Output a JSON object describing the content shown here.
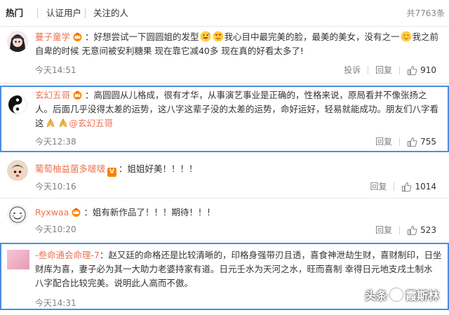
{
  "tabs": [
    {
      "label": "热门",
      "active": true
    },
    {
      "label": "认证用户",
      "active": false
    },
    {
      "label": "关注的人",
      "active": false
    }
  ],
  "total_count": "共7763条",
  "actions": {
    "report": "投诉",
    "reply": "回复"
  },
  "comments": [
    {
      "user": "蔓子童学",
      "badge": "vip-crown",
      "text_parts": [
        "：好想尝试一下圆圆姐的发型",
        "我心目中最完美的脸，最美的美女，没有之一",
        "我之前自卑的时候 无意间被安利糖果 现在靠它减40多 现在真的好看太多了!"
      ],
      "emoji": [
        "grin-sweat-emoji",
        "love-eyes-emoji",
        "shy-emoji"
      ],
      "time": "今天14:51",
      "show_report": true,
      "likes": "910"
    },
    {
      "user": "玄幻五哥",
      "badge": "vip-crown",
      "text": "：高圆圆从儿格成，很有才华，从事演艺事业是正确的，性格来说，原局看并不像张扬之人。后面几乎没得太差的运势，这八字这辈子没的太差的运势，命好运好，轻易就能成功。朋友们八字看这",
      "mention": "@玄幻五哥",
      "emoji": [
        "pray-emoji",
        "pray-emoji"
      ],
      "time": "今天12:38",
      "show_report": false,
      "likes": "755"
    },
    {
      "user": "葡萄柚益菌多啵啵",
      "badge": "V",
      "text": "：姐姐好美！！！！",
      "time": "今天10:16",
      "show_report": false,
      "likes": "1014"
    },
    {
      "user": "Ryxwaa",
      "badge": "vip-crown",
      "text": "：姐有新作品了！！！期待！！！",
      "time": "今天10:20",
      "show_report": false,
      "likes": "523"
    },
    {
      "user": "-叁命通会命理-7",
      "badge": "",
      "text": "：赵又廷的命格还是比较清晰的，印格身强带刃且透，喜食神泄劫生财，喜财制印，日坐财库为喜，妻子必为其一大助力老婆持家有道。日元壬水为天河之水，旺而喜制 幸得日元地支戌土制水 八字配合比较完美。说明此人高而不傲。",
      "time": "今天14:31",
      "show_report": false,
      "likes": ""
    }
  ],
  "watermark": {
    "prefix": "头条",
    "name": "霞斯林"
  },
  "colors": {
    "username": "#eb7350",
    "highlight_border": "#4a8ee0",
    "muted": "#808080"
  }
}
